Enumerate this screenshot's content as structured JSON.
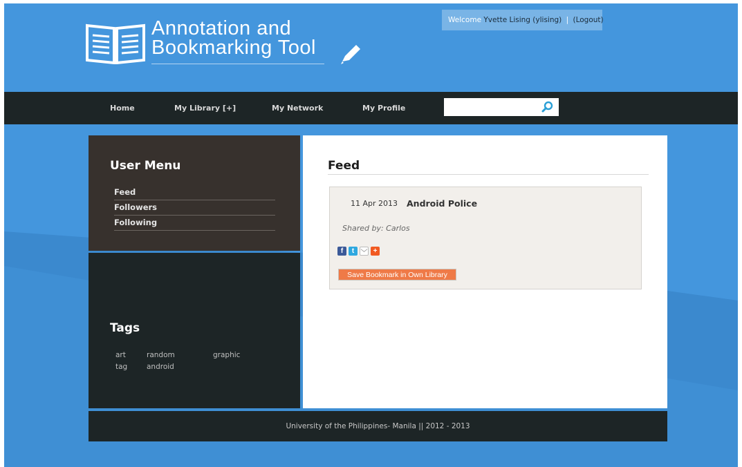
{
  "header": {
    "logo_line1": "Annotation and",
    "logo_line2": "Bookmarking Tool",
    "welcome_label": "Welcome",
    "user_display": "Yvette Lising (ylising)",
    "separator": "|",
    "logout_label": "(Logout)"
  },
  "nav": {
    "items": [
      {
        "label": "Home"
      },
      {
        "label": "My Library [+]"
      },
      {
        "label": "My Network"
      },
      {
        "label": "My Profile"
      }
    ],
    "search": {
      "value": "",
      "placeholder": ""
    }
  },
  "user_menu": {
    "title": "User Menu",
    "items": [
      {
        "label": "Feed"
      },
      {
        "label": "Followers"
      },
      {
        "label": "Following"
      }
    ]
  },
  "tags": {
    "title": "Tags",
    "items": [
      "art",
      "random",
      "graphic",
      "tag",
      "android"
    ]
  },
  "feed": {
    "title": "Feed",
    "entries": [
      {
        "date": "11 Apr 2013",
        "title": "Android Police",
        "shared_by": "Shared by: Carlos",
        "share_icons": [
          "facebook-icon",
          "twitter-icon",
          "email-icon",
          "add-share-icon"
        ],
        "save_label": "Save Bookmark in Own Library"
      }
    ]
  },
  "footer": {
    "text": "University of the Philippines- Manila || 2012 - 2013"
  },
  "colors": {
    "background": "#3f8fd4",
    "nav_bar": "#1d2526",
    "user_menu_panel": "#37312d",
    "save_button": "#ef7a47",
    "card": "#f2efeb"
  }
}
